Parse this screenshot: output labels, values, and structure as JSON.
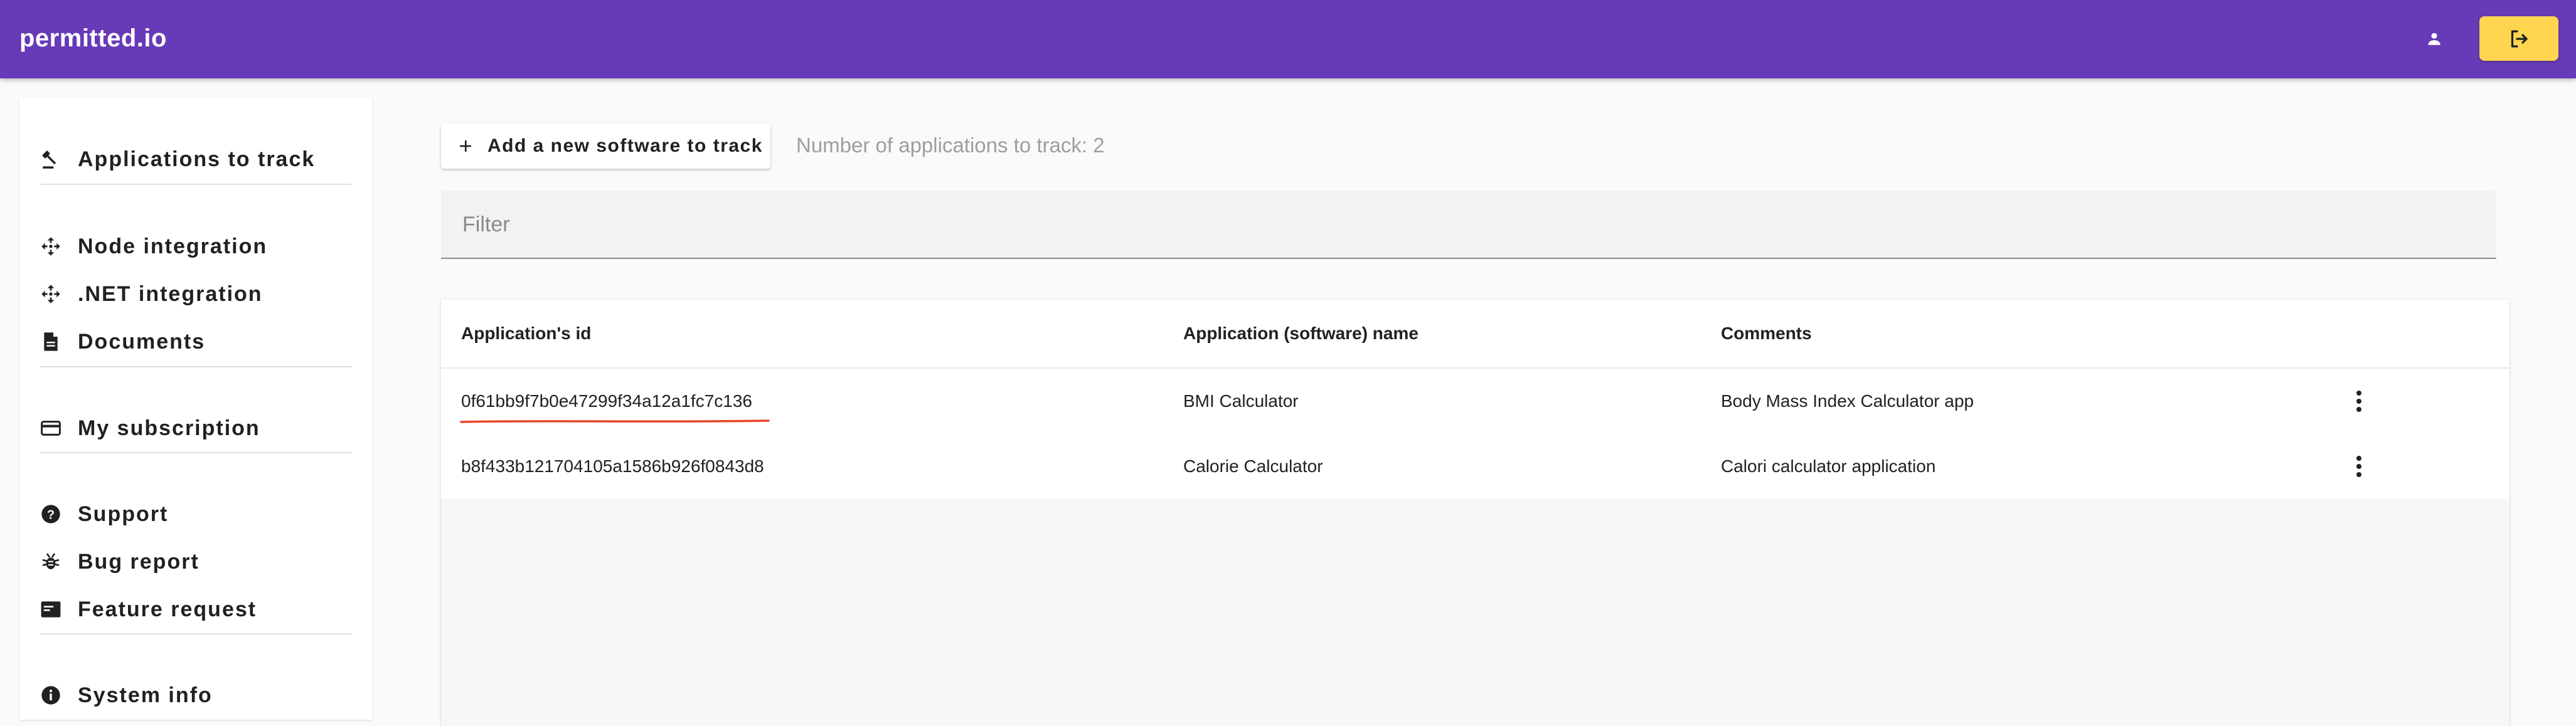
{
  "app": {
    "brand": "permitted.io"
  },
  "topbar": {
    "user_icon": "person-icon",
    "logout_icon": "logout-icon",
    "accent": "#673ab7",
    "logout_color": "#ffd54f"
  },
  "sidebar": {
    "items": [
      {
        "label": "Applications to track",
        "icon": "gavel-icon"
      },
      {
        "label": "Node integration",
        "icon": "integration-icon"
      },
      {
        "label": ".NET integration",
        "icon": "integration-icon"
      },
      {
        "label": "Documents",
        "icon": "document-icon"
      },
      {
        "label": "My subscription",
        "icon": "credit-card-icon"
      },
      {
        "label": "Support",
        "icon": "help-icon"
      },
      {
        "label": "Bug report",
        "icon": "bug-icon"
      },
      {
        "label": "Feature request",
        "icon": "feature-request-icon"
      },
      {
        "label": "System info",
        "icon": "info-icon"
      }
    ]
  },
  "main": {
    "add_button_label": "Add a new software to track",
    "count_text": "Number of applications to track: 2",
    "filter_placeholder": "Filter",
    "filter_value": "",
    "table": {
      "columns": [
        "Application's id",
        "Application (software) name",
        "Comments"
      ],
      "rows": [
        {
          "id": "0f61bb9f7b0e47299f34a12a1fc7c136",
          "name": "BMI Calculator",
          "comments": "Body Mass Index Calculator app",
          "highlighted": true,
          "highlight_color": "#e8472b"
        },
        {
          "id": "b8f433b121704105a1586b926f0843d8",
          "name": "Calorie Calculator",
          "comments": "Calori calculator application",
          "highlighted": false
        }
      ]
    }
  }
}
